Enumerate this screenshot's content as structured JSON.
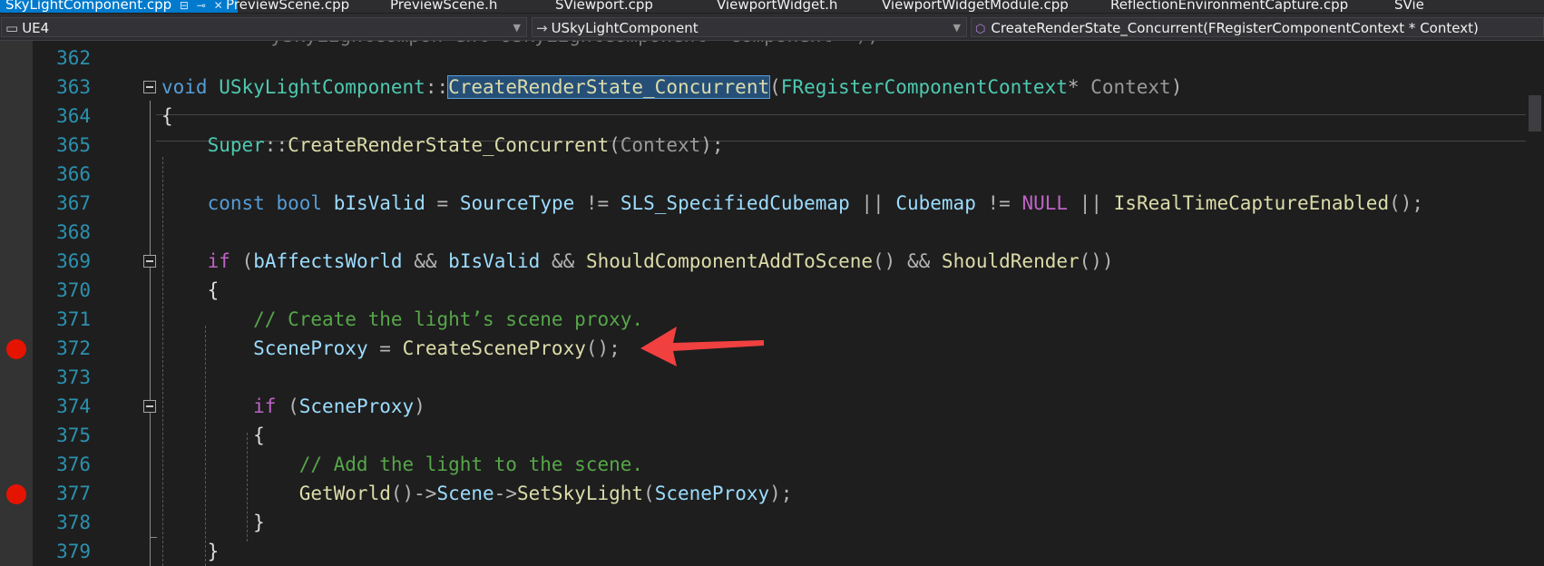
{
  "tabs": [
    {
      "label": "SkyLightComponent.cpp",
      "active": true
    },
    {
      "label": "PreviewScene.cpp"
    },
    {
      "label": "PreviewScene.h"
    },
    {
      "label": "SViewport.cpp"
    },
    {
      "label": "ViewportWidget.h"
    },
    {
      "label": "ViewportWidgetModule.cpp"
    },
    {
      "label": "ReflectionEnvironmentCapture.cpp"
    },
    {
      "label": "SVie"
    }
  ],
  "navbar": {
    "project": "UE4",
    "scope": "USkyLightComponent",
    "member": "CreateRenderState_Concurrent(FRegisterComponentContext * Context)"
  },
  "colors": {
    "accent": "#007acc",
    "breakpoint": "#e51400",
    "line_number": "#2b91af",
    "arrow": "#f04040"
  },
  "editor": {
    "lines": [
      {
        "num": "362",
        "text": ""
      },
      {
        "num": "363",
        "text": "void USkyLightComponent::CreateRenderState_Concurrent(FRegisterComponentContext* Context)"
      },
      {
        "num": "364",
        "text": "{"
      },
      {
        "num": "365",
        "text": "Super::CreateRenderState_Concurrent(Context);"
      },
      {
        "num": "366",
        "text": ""
      },
      {
        "num": "367",
        "text": "const bool bIsValid = SourceType != SLS_SpecifiedCubemap || Cubemap != NULL || IsRealTimeCaptureEnabled();"
      },
      {
        "num": "368",
        "text": ""
      },
      {
        "num": "369",
        "text": "if (bAffectsWorld && bIsValid && ShouldComponentAddToScene() && ShouldRender())"
      },
      {
        "num": "370",
        "text": "{"
      },
      {
        "num": "371",
        "text": "// Create the light's scene proxy."
      },
      {
        "num": "372",
        "text": "SceneProxy = CreateSceneProxy();",
        "breakpoint": true
      },
      {
        "num": "373",
        "text": ""
      },
      {
        "num": "374",
        "text": "if (SceneProxy)"
      },
      {
        "num": "375",
        "text": "{"
      },
      {
        "num": "376",
        "text": "// Add the light to the scene."
      },
      {
        "num": "377",
        "text": "GetWorld()->Scene->SetSkyLight(SceneProxy);",
        "breakpoint": true
      },
      {
        "num": "378",
        "text": "}"
      },
      {
        "num": "379",
        "text": "}"
      }
    ]
  }
}
